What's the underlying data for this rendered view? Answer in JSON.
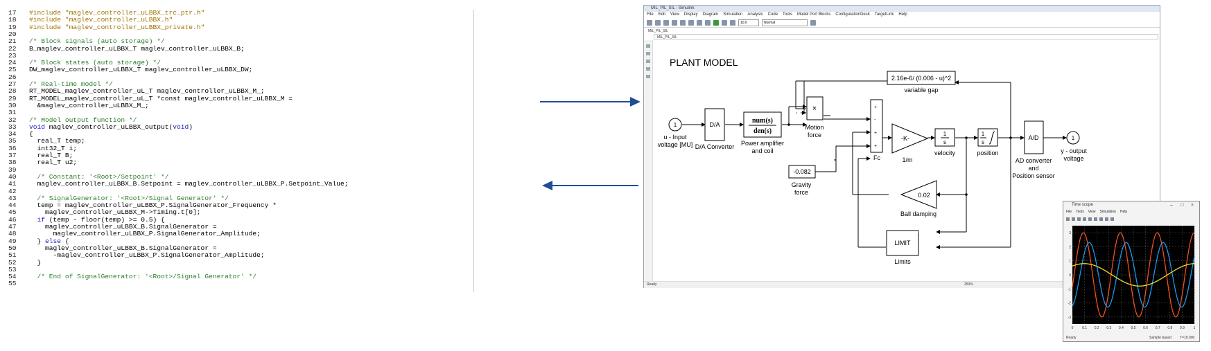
{
  "code": {
    "lines": [
      {
        "num": "17",
        "text": "#include \"maglev_controller_uLBBX_trc_ptr.h\"",
        "kind": "pp"
      },
      {
        "num": "18",
        "text": "#include \"maglev_controller_uLBBX.h\"",
        "kind": "pp"
      },
      {
        "num": "19",
        "text": "#include \"maglev_controller_uLBBX_private.h\"",
        "kind": "pp"
      },
      {
        "num": "20",
        "text": "",
        "kind": "code"
      },
      {
        "num": "21",
        "text": "/* Block signals (auto storage) */",
        "kind": "cmt"
      },
      {
        "num": "22",
        "text": "B_maglev_controller_uLBBX_T maglev_controller_uLBBX_B;",
        "kind": "code"
      },
      {
        "num": "23",
        "text": "",
        "kind": "code"
      },
      {
        "num": "24",
        "text": "/* Block states (auto storage) */",
        "kind": "cmt"
      },
      {
        "num": "25",
        "text": "DW_maglev_controller_uLBBX_T maglev_controller_uLBBX_DW;",
        "kind": "code"
      },
      {
        "num": "26",
        "text": "",
        "kind": "code"
      },
      {
        "num": "27",
        "text": "/* Real-time model */",
        "kind": "cmt"
      },
      {
        "num": "28",
        "text": "RT_MODEL_maglev_controller_uL_T maglev_controller_uLBBX_M_;",
        "kind": "code"
      },
      {
        "num": "29",
        "text": "RT_MODEL_maglev_controller_uL_T *const maglev_controller_uLBBX_M =",
        "kind": "code"
      },
      {
        "num": "30",
        "text": "  &maglev_controller_uLBBX_M_;",
        "kind": "code"
      },
      {
        "num": "31",
        "text": "",
        "kind": "code"
      },
      {
        "num": "32",
        "text": "/* Model output function */",
        "kind": "cmt"
      },
      {
        "num": "33",
        "pre": "",
        "kw": "void",
        "post": " maglev_controller_uLBBX_output(",
        "kw2": "void",
        "post2": ")",
        "kind": "mixed"
      },
      {
        "num": "34",
        "text": "{",
        "kind": "code"
      },
      {
        "num": "35",
        "text": "  real_T temp;",
        "kind": "code"
      },
      {
        "num": "36",
        "text": "  int32_T i;",
        "kind": "code"
      },
      {
        "num": "37",
        "text": "  real_T B;",
        "kind": "code"
      },
      {
        "num": "38",
        "text": "  real_T u2;",
        "kind": "code"
      },
      {
        "num": "39",
        "text": "",
        "kind": "code"
      },
      {
        "num": "40",
        "text": "  /* Constant: '<Root>/Setpoint' */",
        "kind": "cmt"
      },
      {
        "num": "41",
        "text": "  maglev_controller_uLBBX_B.Setpoint = maglev_controller_uLBBX_P.Setpoint_Value;",
        "kind": "code"
      },
      {
        "num": "42",
        "text": "",
        "kind": "code"
      },
      {
        "num": "43",
        "text": "  /* SignalGenerator: '<Root>/Signal Generator' */",
        "kind": "cmt"
      },
      {
        "num": "44",
        "text": "  temp = maglev_controller_uLBBX_P.SignalGenerator_Frequency *",
        "kind": "code"
      },
      {
        "num": "45",
        "text": "    maglev_controller_uLBBX_M->Timing.t[0];",
        "kind": "code"
      },
      {
        "num": "46",
        "pre": "  ",
        "kw": "if",
        "post": " (temp - floor(temp) >= 0.5) {",
        "kind": "mixed"
      },
      {
        "num": "47",
        "text": "    maglev_controller_uLBBX_B.SignalGenerator =",
        "kind": "code"
      },
      {
        "num": "48",
        "text": "      maglev_controller_uLBBX_P.SignalGenerator_Amplitude;",
        "kind": "code"
      },
      {
        "num": "49",
        "pre": "  } ",
        "kw": "else",
        "post": " {",
        "kind": "mixed"
      },
      {
        "num": "50",
        "text": "    maglev_controller_uLBBX_B.SignalGenerator =",
        "kind": "code"
      },
      {
        "num": "51",
        "text": "      -maglev_controller_uLBBX_P.SignalGenerator_Amplitude;",
        "kind": "code"
      },
      {
        "num": "52",
        "text": "  }",
        "kind": "code"
      },
      {
        "num": "53",
        "text": "",
        "kind": "code"
      },
      {
        "num": "54",
        "text": "  /* End of SignalGenerator: '<Root>/Signal Generator' */",
        "kind": "cmt"
      },
      {
        "num": "55",
        "text": "",
        "kind": "code"
      }
    ]
  },
  "colors": {
    "arrow": "#1f4e96",
    "comment": "#2d7e2d",
    "preprocessor": "#a07400",
    "keyword": "#1c1cc4",
    "scope_bg": "#000000",
    "scope_grid": "#5a5a5a",
    "trace_orange": "#f0501e",
    "trace_blue": "#1e96f0",
    "trace_yellow": "#f0dc28"
  },
  "simulink": {
    "title": "MIL_PIL_SIL - Simulink",
    "menu": [
      "File",
      "Edit",
      "View",
      "Display",
      "Diagram",
      "Simulation",
      "Analysis",
      "Code",
      "Tools",
      "Model Port Blocks",
      "ConfigurationDesk",
      "TargetLink",
      "Help"
    ],
    "stop_time": "10.0",
    "mode": "Normal",
    "tab": "MIL_PIL_SIL",
    "address": "MIL_PIL_SIL",
    "status_left": "Ready",
    "status_zoom": "250%",
    "diagram": {
      "title": "PLANT MODEL",
      "input_port_num": "1",
      "input_label_1": "u - Input",
      "input_label_2": "voltage [MU]",
      "da_block": "D/A",
      "da_label": "D/A Converter",
      "tf_num": "num(s)",
      "tf_den": "den(s)",
      "tf_label_1": "Power amplifier",
      "tf_label_2": "and coil",
      "product_symbol": "×",
      "product_label_1": "Motion",
      "product_label_2": "force",
      "gap_expr": "2.16e-6/ (0.006 - u)^2",
      "gap_label": "variable gap",
      "sum_signs": [
        "+",
        "-",
        "+",
        "+"
      ],
      "sum_label": "Fc",
      "gain_text": "-K-",
      "gain_label": "1/m",
      "int1_num": "1",
      "int1_den": "s",
      "int1_label": "velocity",
      "int2_num": "1",
      "int2_den": "s",
      "int2_label": "position",
      "ad_block": "A/D",
      "ad_label_1": "AD converter",
      "ad_label_2": "and",
      "ad_label_3": "Position sensor",
      "output_port_num": "1",
      "output_label_1": "y - output",
      "output_label_2": "voltage",
      "gravity_value": "-0.082",
      "gravity_label_1": "Gravity",
      "gravity_label_2": "force",
      "damping_value": "0.02",
      "damping_label": "Ball damping",
      "limit_block": "LIMIT",
      "limit_label": "Limits"
    }
  },
  "scope": {
    "title": "Time scope",
    "menu": [
      "File",
      "Tools",
      "View",
      "Simulation",
      "Help"
    ],
    "status_left": "Ready",
    "status_right_1": "Sample based",
    "status_right_2": "T=10.000",
    "y_ticks": [
      "3",
      "2",
      "1",
      "0",
      "-1",
      "-2",
      "-3"
    ],
    "x_ticks": [
      "0",
      "0.1",
      "0.2",
      "0.3",
      "0.4",
      "0.5",
      "0.6",
      "0.7",
      "0.8",
      "0.9",
      "1"
    ]
  },
  "chart_data": {
    "type": "line",
    "ylim": [
      -3.5,
      3.5
    ],
    "xlim": [
      0,
      1
    ],
    "grid": true,
    "series": [
      {
        "color": "#f0501e",
        "amplitude": 3.0,
        "frequency": 3.3,
        "phase": -0.3,
        "offset": 0
      },
      {
        "color": "#1e96f0",
        "amplitude": 2.3,
        "frequency": 3.3,
        "phase": -1.3,
        "offset": 0
      },
      {
        "color": "#f0dc28",
        "amplitude": 0.8,
        "frequency": 1.1,
        "phase": 0.9,
        "offset": 0
      }
    ]
  }
}
